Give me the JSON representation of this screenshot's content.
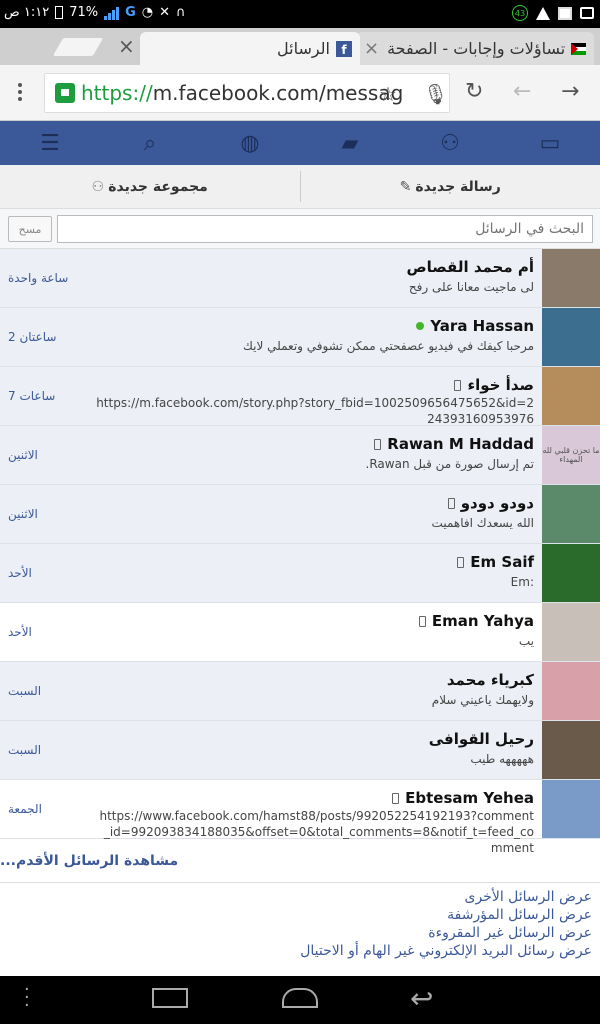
{
  "status_bar": {
    "time": "١:١٢ ص",
    "battery": "71%",
    "network": "G",
    "notif_count": "43"
  },
  "tabs": [
    {
      "title": "الرسائل",
      "favicon": "facebook-icon"
    },
    {
      "title": "تساؤلات وإجابات - الصفحة",
      "favicon": "palestine-flag-icon"
    }
  ],
  "omnibox": {
    "scheme": "https://",
    "url": "m.facebook.com/messag"
  },
  "actions": {
    "new_message": "رسالة جديدة",
    "new_group": "مجموعة جديدة"
  },
  "search": {
    "placeholder": "البحث في الرسائل",
    "clear_label": "مسح"
  },
  "threads": [
    {
      "name": "أم محمد القصاص",
      "snippet": "لى ماجيت معانا على رفح",
      "time": "ساعة واحدة",
      "read": false,
      "avatar_color": "#8a7a6a"
    },
    {
      "name": "Yara Hassan",
      "snippet": "مرحبا كيفك في فيديو عصفحتي ممكن تشوفي وتعملي لايك",
      "time": "2 ساعتان",
      "read": false,
      "online": true,
      "avatar_color": "#3c6f8f"
    },
    {
      "name": "صدأ خواء",
      "snippet": "https://m.facebook.com/story.php?story_fbid=1002509656475652&id=224393160953976",
      "time": "7 ساعات",
      "read": false,
      "avatar_color": "#b58c5c"
    },
    {
      "name": "Rawan M Haddad",
      "snippet": "تم إرسال صورة من قبل Rawan.",
      "time": "الاثنين",
      "read": false,
      "avatar_color": "#d8c8d8",
      "avatar_text": "ما تحزن قلبي لله المهداء"
    },
    {
      "name": "دودو دودو",
      "snippet": "الله يسعدك افاهميت",
      "time": "الاثنين",
      "read": false,
      "avatar_color": "#5a8a6a"
    },
    {
      "name": "Em Saif",
      "snippet": ":Em",
      "time": "الأحد",
      "read": false,
      "avatar_color": "#2a6a2a"
    },
    {
      "name": "Eman Yahya",
      "snippet": "يب",
      "time": "الأحد",
      "read": true,
      "avatar_color": "#c8c0b8"
    },
    {
      "name": "كبرياء محمد",
      "snippet": "ولايهمك ياعيني سلام",
      "time": "السبت",
      "read": false,
      "avatar_color": "#d8a0a8"
    },
    {
      "name": "رحيل القوافى",
      "snippet": "هههههه طيب",
      "time": "السبت",
      "read": false,
      "avatar_color": "#6a5a4a"
    },
    {
      "name": "Ebtesam Yehea",
      "snippet": "https://www.facebook.com/hamst88/posts/992052254192193?comment_id=992093834188035&offset=0&total_comments=8&notif_t=feed_comment",
      "time": "الجمعة",
      "read": true,
      "avatar_color": "#7a9ac8"
    }
  ],
  "older_messages": "مشاهدة الرسائل الأقدم...",
  "footer_links": [
    "عرض الرسائل الأخرى",
    "عرض الرسائل المؤرشفة",
    "عرض الرسائل غير المقروءة",
    "عرض رسائل البريد الإلكتروني غير الهام أو الاحتيال"
  ]
}
